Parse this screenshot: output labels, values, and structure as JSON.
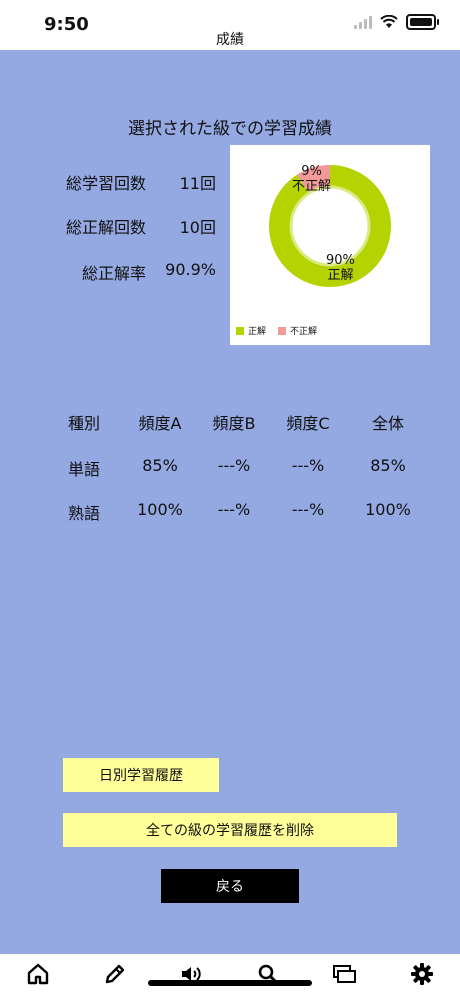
{
  "status": {
    "time": "9:50"
  },
  "nav": {
    "title": "成績"
  },
  "main": {
    "section_title": "選択された級での学習成績",
    "summary": [
      {
        "label": "総学習回数",
        "value": "11回"
      },
      {
        "label": "総正解回数",
        "value": "10回"
      },
      {
        "label": "総正解率",
        "value": "90.9%"
      }
    ]
  },
  "chart_data": {
    "type": "pie",
    "slices": [
      {
        "name": "正解",
        "value": 90,
        "label": "90%",
        "color": "#b5d300"
      },
      {
        "name": "不正解",
        "value": 9,
        "label": "9%",
        "color": "#f29a9a"
      }
    ],
    "legend": [
      "正解",
      "不正解"
    ],
    "legend_position": "bottom-left"
  },
  "table": {
    "headers": [
      "種別",
      "頻度A",
      "頻度B",
      "頻度C",
      "全体"
    ],
    "rows": [
      [
        "単語",
        "85%",
        "---%",
        "---%",
        "85%"
      ],
      [
        "熟語",
        "100%",
        "---%",
        "---%",
        "100%"
      ]
    ]
  },
  "buttons": {
    "daily_history": "日別学習履歴",
    "delete_all": "全ての級の学習履歴を削除",
    "back": "戻る"
  },
  "tabbar": {
    "icons": [
      "home-icon",
      "pencil-icon",
      "speaker-icon",
      "search-icon",
      "cards-icon",
      "gear-icon"
    ]
  },
  "colors": {
    "background": "#94a8e2",
    "button_yellow": "#ffff99",
    "button_black": "#000000",
    "correct": "#b5d300",
    "incorrect": "#f29a9a"
  }
}
